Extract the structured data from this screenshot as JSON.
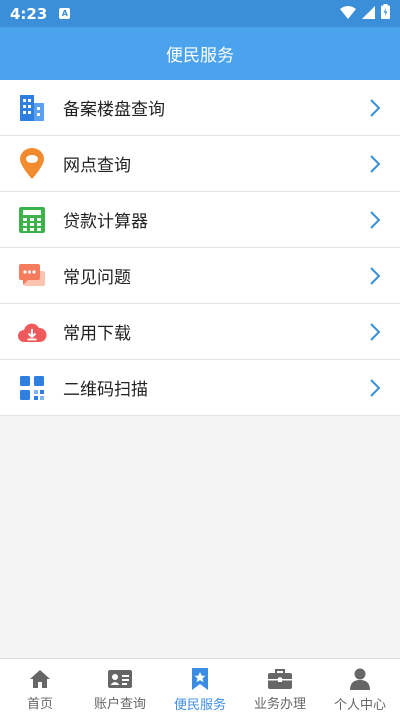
{
  "status": {
    "time": "4:23",
    "notification": "A"
  },
  "header": {
    "title": "便民服务"
  },
  "menu": [
    {
      "label": "备案楼盘查询",
      "icon": "building-icon",
      "color": "#2f7fe0"
    },
    {
      "label": "网点查询",
      "icon": "location-pin-icon",
      "color": "#f28a2e"
    },
    {
      "label": "贷款计算器",
      "icon": "calculator-icon",
      "color": "#3bb34a"
    },
    {
      "label": "常见问题",
      "icon": "chat-bubble-icon",
      "color": "#f47b5b"
    },
    {
      "label": "常用下载",
      "icon": "cloud-download-icon",
      "color": "#f05a5a"
    },
    {
      "label": "二维码扫描",
      "icon": "qr-code-icon",
      "color": "#2f7fe0"
    }
  ],
  "tabs": [
    {
      "label": "首页",
      "icon": "home-icon",
      "active": false
    },
    {
      "label": "账户查询",
      "icon": "id-card-icon",
      "active": false
    },
    {
      "label": "便民服务",
      "icon": "bookmark-star-icon",
      "active": true
    },
    {
      "label": "业务办理",
      "icon": "briefcase-icon",
      "active": false
    },
    {
      "label": "个人中心",
      "icon": "person-icon",
      "active": false
    }
  ],
  "colors": {
    "statusbar": "#3a8fd8",
    "appbar": "#4aa3ec",
    "accent": "#3b8de3",
    "chevron": "#3a8fd8"
  }
}
